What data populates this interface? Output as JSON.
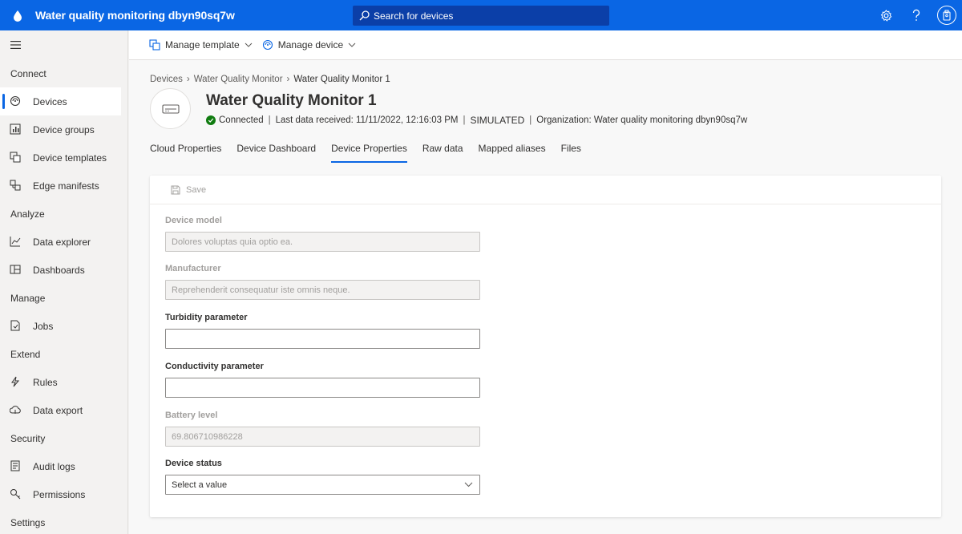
{
  "app": {
    "title": "Water quality monitoring dbyn90sq7w",
    "search_placeholder": "Search for devices",
    "accent_color": "#0a66e4"
  },
  "top_icons": [
    "gear-icon",
    "help-icon",
    "account-icon"
  ],
  "sidebar": {
    "sections": [
      {
        "title": "Connect",
        "items": [
          {
            "label": "Devices",
            "icon": "devices-icon",
            "active": true
          },
          {
            "label": "Device groups",
            "icon": "device-groups-icon"
          },
          {
            "label": "Device templates",
            "icon": "device-templates-icon"
          },
          {
            "label": "Edge manifests",
            "icon": "edge-manifests-icon"
          }
        ]
      },
      {
        "title": "Analyze",
        "items": [
          {
            "label": "Data explorer",
            "icon": "data-explorer-icon"
          },
          {
            "label": "Dashboards",
            "icon": "dashboards-icon"
          }
        ]
      },
      {
        "title": "Manage",
        "items": [
          {
            "label": "Jobs",
            "icon": "jobs-icon"
          }
        ]
      },
      {
        "title": "Extend",
        "items": [
          {
            "label": "Rules",
            "icon": "rules-icon"
          },
          {
            "label": "Data export",
            "icon": "data-export-icon"
          }
        ]
      },
      {
        "title": "Security",
        "items": [
          {
            "label": "Audit logs",
            "icon": "audit-logs-icon"
          },
          {
            "label": "Permissions",
            "icon": "permissions-icon"
          }
        ]
      },
      {
        "title": "Settings",
        "items": []
      }
    ]
  },
  "commandbar": {
    "manage_template": "Manage template",
    "manage_device": "Manage device"
  },
  "breadcrumb": {
    "root": "Devices",
    "parent": "Water Quality Monitor",
    "current": "Water Quality Monitor 1"
  },
  "device": {
    "title": "Water Quality Monitor 1",
    "status": "Connected",
    "last_data": "Last data received: 11/11/2022, 12:16:03 PM",
    "simulated": "SIMULATED",
    "organization": "Organization: Water quality monitoring dbyn90sq7w"
  },
  "tabs": [
    "Cloud Properties",
    "Device Dashboard",
    "Device Properties",
    "Raw data",
    "Mapped aliases",
    "Files"
  ],
  "active_tab": "Device Properties",
  "form": {
    "save_label": "Save",
    "fields": {
      "device_model": {
        "label": "Device model",
        "value": "Dolores voluptas quia optio ea."
      },
      "manufacturer": {
        "label": "Manufacturer",
        "value": "Reprehenderit consequatur iste omnis neque."
      },
      "turbidity": {
        "label": "Turbidity parameter",
        "value": ""
      },
      "conductivity": {
        "label": "Conductivity parameter",
        "value": ""
      },
      "battery": {
        "label": "Battery level",
        "value": "69.806710986228"
      },
      "device_status": {
        "label": "Device status",
        "placeholder": "Select a value"
      }
    }
  }
}
